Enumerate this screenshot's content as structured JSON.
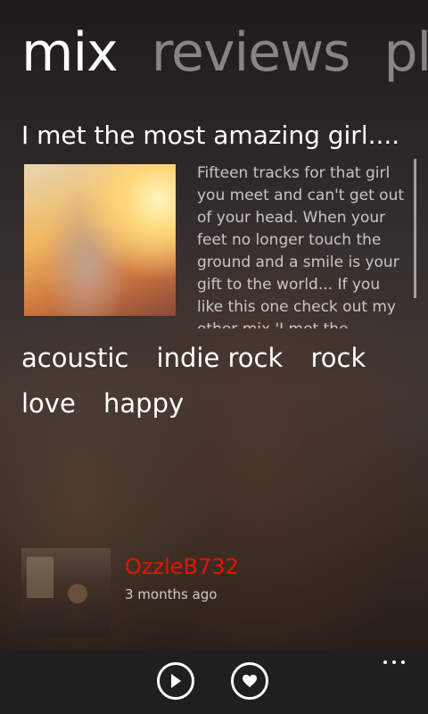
{
  "pivot": {
    "items": [
      "mix",
      "reviews",
      "pla"
    ]
  },
  "mix": {
    "title": "I met the most amazing girl....",
    "description": "Fifteen tracks for that girl you meet and can't get out of your head. When your feet no longer touch the ground and a smile is your gift to the world... If you like this one check out my other mix 'I met the",
    "tags": [
      "acoustic",
      "indie rock",
      "rock",
      "love",
      "happy"
    ]
  },
  "author": {
    "name": "OzzleB732",
    "time": "3 months ago"
  },
  "appbar": {
    "play_icon": "play-icon",
    "love_icon": "heart-icon",
    "more_icon": "ellipsis-icon"
  },
  "colors": {
    "accent": "#e51400",
    "appbar": "#1f1f1f"
  }
}
